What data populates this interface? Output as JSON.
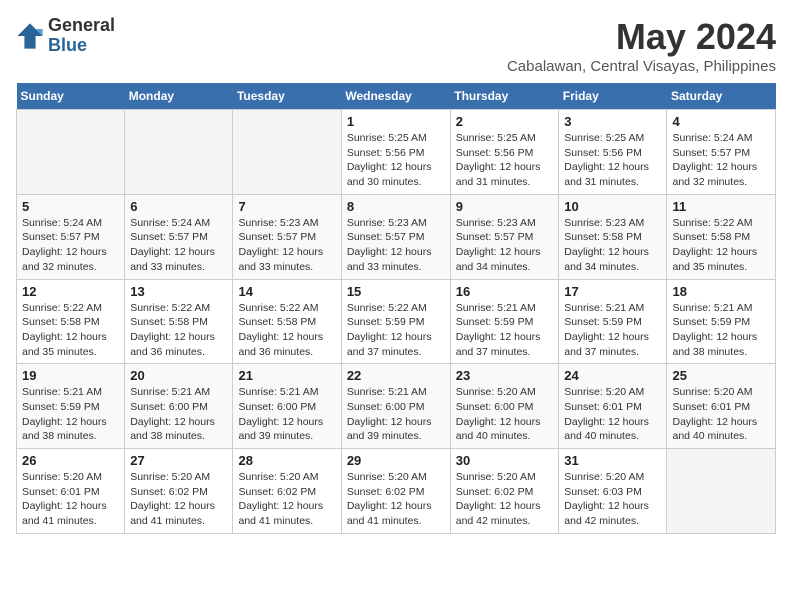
{
  "logo": {
    "general": "General",
    "blue": "Blue"
  },
  "title": "May 2024",
  "subtitle": "Cabalawan, Central Visayas, Philippines",
  "days_of_week": [
    "Sunday",
    "Monday",
    "Tuesday",
    "Wednesday",
    "Thursday",
    "Friday",
    "Saturday"
  ],
  "weeks": [
    [
      {
        "day": "",
        "info": ""
      },
      {
        "day": "",
        "info": ""
      },
      {
        "day": "",
        "info": ""
      },
      {
        "day": "1",
        "info": "Sunrise: 5:25 AM\nSunset: 5:56 PM\nDaylight: 12 hours\nand 30 minutes."
      },
      {
        "day": "2",
        "info": "Sunrise: 5:25 AM\nSunset: 5:56 PM\nDaylight: 12 hours\nand 31 minutes."
      },
      {
        "day": "3",
        "info": "Sunrise: 5:25 AM\nSunset: 5:56 PM\nDaylight: 12 hours\nand 31 minutes."
      },
      {
        "day": "4",
        "info": "Sunrise: 5:24 AM\nSunset: 5:57 PM\nDaylight: 12 hours\nand 32 minutes."
      }
    ],
    [
      {
        "day": "5",
        "info": "Sunrise: 5:24 AM\nSunset: 5:57 PM\nDaylight: 12 hours\nand 32 minutes."
      },
      {
        "day": "6",
        "info": "Sunrise: 5:24 AM\nSunset: 5:57 PM\nDaylight: 12 hours\nand 33 minutes."
      },
      {
        "day": "7",
        "info": "Sunrise: 5:23 AM\nSunset: 5:57 PM\nDaylight: 12 hours\nand 33 minutes."
      },
      {
        "day": "8",
        "info": "Sunrise: 5:23 AM\nSunset: 5:57 PM\nDaylight: 12 hours\nand 33 minutes."
      },
      {
        "day": "9",
        "info": "Sunrise: 5:23 AM\nSunset: 5:57 PM\nDaylight: 12 hours\nand 34 minutes."
      },
      {
        "day": "10",
        "info": "Sunrise: 5:23 AM\nSunset: 5:58 PM\nDaylight: 12 hours\nand 34 minutes."
      },
      {
        "day": "11",
        "info": "Sunrise: 5:22 AM\nSunset: 5:58 PM\nDaylight: 12 hours\nand 35 minutes."
      }
    ],
    [
      {
        "day": "12",
        "info": "Sunrise: 5:22 AM\nSunset: 5:58 PM\nDaylight: 12 hours\nand 35 minutes."
      },
      {
        "day": "13",
        "info": "Sunrise: 5:22 AM\nSunset: 5:58 PM\nDaylight: 12 hours\nand 36 minutes."
      },
      {
        "day": "14",
        "info": "Sunrise: 5:22 AM\nSunset: 5:58 PM\nDaylight: 12 hours\nand 36 minutes."
      },
      {
        "day": "15",
        "info": "Sunrise: 5:22 AM\nSunset: 5:59 PM\nDaylight: 12 hours\nand 37 minutes."
      },
      {
        "day": "16",
        "info": "Sunrise: 5:21 AM\nSunset: 5:59 PM\nDaylight: 12 hours\nand 37 minutes."
      },
      {
        "day": "17",
        "info": "Sunrise: 5:21 AM\nSunset: 5:59 PM\nDaylight: 12 hours\nand 37 minutes."
      },
      {
        "day": "18",
        "info": "Sunrise: 5:21 AM\nSunset: 5:59 PM\nDaylight: 12 hours\nand 38 minutes."
      }
    ],
    [
      {
        "day": "19",
        "info": "Sunrise: 5:21 AM\nSunset: 5:59 PM\nDaylight: 12 hours\nand 38 minutes."
      },
      {
        "day": "20",
        "info": "Sunrise: 5:21 AM\nSunset: 6:00 PM\nDaylight: 12 hours\nand 38 minutes."
      },
      {
        "day": "21",
        "info": "Sunrise: 5:21 AM\nSunset: 6:00 PM\nDaylight: 12 hours\nand 39 minutes."
      },
      {
        "day": "22",
        "info": "Sunrise: 5:21 AM\nSunset: 6:00 PM\nDaylight: 12 hours\nand 39 minutes."
      },
      {
        "day": "23",
        "info": "Sunrise: 5:20 AM\nSunset: 6:00 PM\nDaylight: 12 hours\nand 40 minutes."
      },
      {
        "day": "24",
        "info": "Sunrise: 5:20 AM\nSunset: 6:01 PM\nDaylight: 12 hours\nand 40 minutes."
      },
      {
        "day": "25",
        "info": "Sunrise: 5:20 AM\nSunset: 6:01 PM\nDaylight: 12 hours\nand 40 minutes."
      }
    ],
    [
      {
        "day": "26",
        "info": "Sunrise: 5:20 AM\nSunset: 6:01 PM\nDaylight: 12 hours\nand 41 minutes."
      },
      {
        "day": "27",
        "info": "Sunrise: 5:20 AM\nSunset: 6:02 PM\nDaylight: 12 hours\nand 41 minutes."
      },
      {
        "day": "28",
        "info": "Sunrise: 5:20 AM\nSunset: 6:02 PM\nDaylight: 12 hours\nand 41 minutes."
      },
      {
        "day": "29",
        "info": "Sunrise: 5:20 AM\nSunset: 6:02 PM\nDaylight: 12 hours\nand 41 minutes."
      },
      {
        "day": "30",
        "info": "Sunrise: 5:20 AM\nSunset: 6:02 PM\nDaylight: 12 hours\nand 42 minutes."
      },
      {
        "day": "31",
        "info": "Sunrise: 5:20 AM\nSunset: 6:03 PM\nDaylight: 12 hours\nand 42 minutes."
      },
      {
        "day": "",
        "info": ""
      }
    ]
  ]
}
